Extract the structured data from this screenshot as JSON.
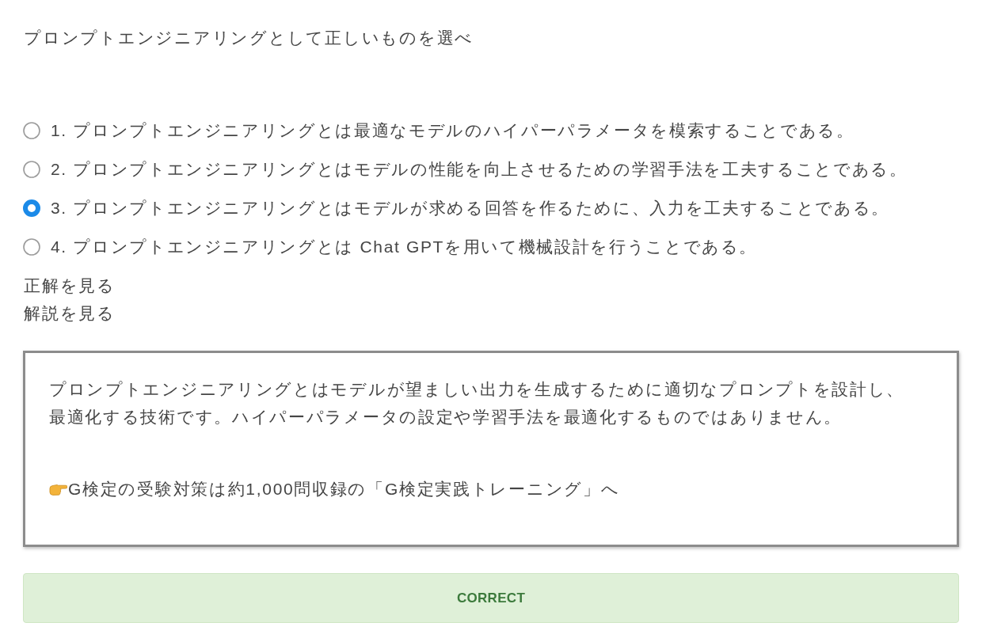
{
  "question": "プロンプトエンジニアリングとして正しいものを選べ",
  "options": [
    {
      "label": "1. プロンプトエンジニアリングとは最適なモデルのハイパーパラメータを模索することである。",
      "selected": false
    },
    {
      "label": "2. プロンプトエンジニアリングとはモデルの性能を向上させるための学習手法を工夫することである。",
      "selected": false
    },
    {
      "label": "3. プロンプトエンジニアリングとはモデルが求める回答を作るために、入力を工夫することである。",
      "selected": true
    },
    {
      "label": "4. プロンプトエンジニアリングとは Chat GPTを用いて機械設計を行うことである。",
      "selected": false
    }
  ],
  "links": [
    {
      "label": "正解を見る"
    },
    {
      "label": "解説を見る"
    }
  ],
  "explanation": {
    "text": "プロンプトエンジニアリングとはモデルが望ましい出力を生成するために適切なプロンプトを設計し、最適化する技術です。ハイパーパラメータの設定や学習手法を最適化するものではありません。",
    "promo": "G検定の受験対策は約1,000問収録の「G検定実践トレーニング」へ"
  },
  "result": {
    "kind": "correct",
    "label": "CORRECT"
  }
}
